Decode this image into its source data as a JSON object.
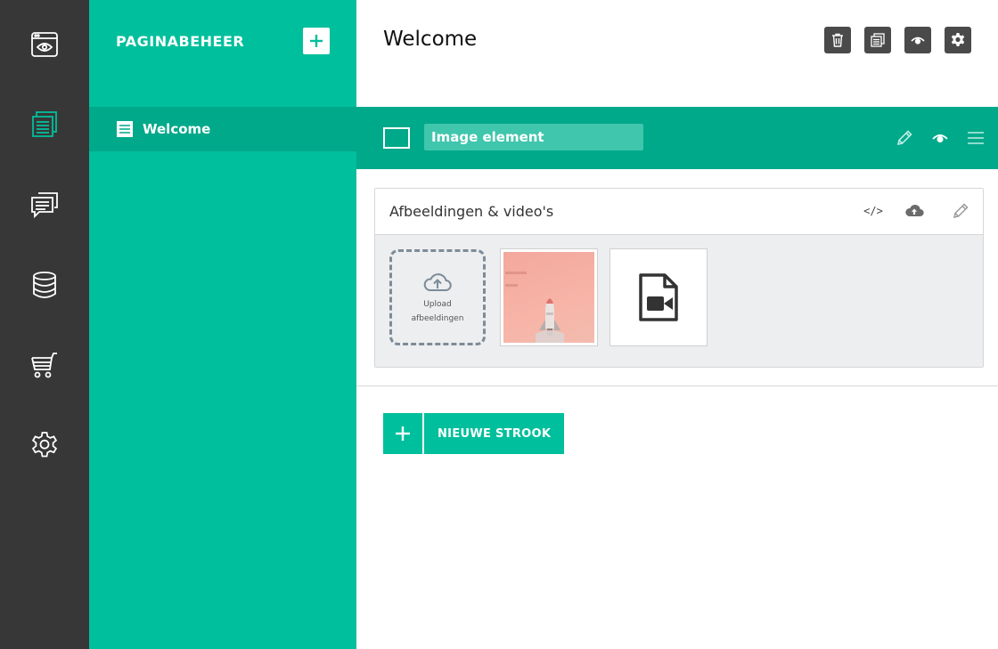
{
  "colors": {
    "rail": "#373737",
    "accent": "#00bf9c",
    "accent_dark": "#00a98a",
    "header_button": "#4a4a4a"
  },
  "rail": {
    "items": [
      {
        "icon": "browser-eye-icon",
        "active": false
      },
      {
        "icon": "pages-icon",
        "active": true
      },
      {
        "icon": "chat-icon",
        "active": false
      },
      {
        "icon": "database-icon",
        "active": false
      },
      {
        "icon": "cart-icon",
        "active": false
      },
      {
        "icon": "gear-icon",
        "active": false
      }
    ]
  },
  "sidebar": {
    "title": "PAGINABEHEER",
    "add_icon": "plus-icon",
    "pages": [
      {
        "label": "Welcome",
        "icon": "page-lines-icon",
        "selected": true
      }
    ]
  },
  "header": {
    "title": "Welcome",
    "buttons": [
      {
        "icon": "trash-icon"
      },
      {
        "icon": "duplicate-icon"
      },
      {
        "icon": "eye-icon"
      },
      {
        "icon": "gear-icon"
      }
    ]
  },
  "element": {
    "name": "Image element",
    "icons": [
      "pencil-icon",
      "eye-icon",
      "menu-icon"
    ]
  },
  "media_panel": {
    "title": "Afbeeldingen & video's",
    "code_label": "</>",
    "upload": {
      "line1": "Upload",
      "line2": "afbeeldingen"
    },
    "items": [
      {
        "type": "image",
        "icon": "rocket-image"
      },
      {
        "type": "video",
        "icon": "video-file-icon"
      }
    ]
  },
  "new_row": {
    "label": "NIEUWE STROOK"
  }
}
